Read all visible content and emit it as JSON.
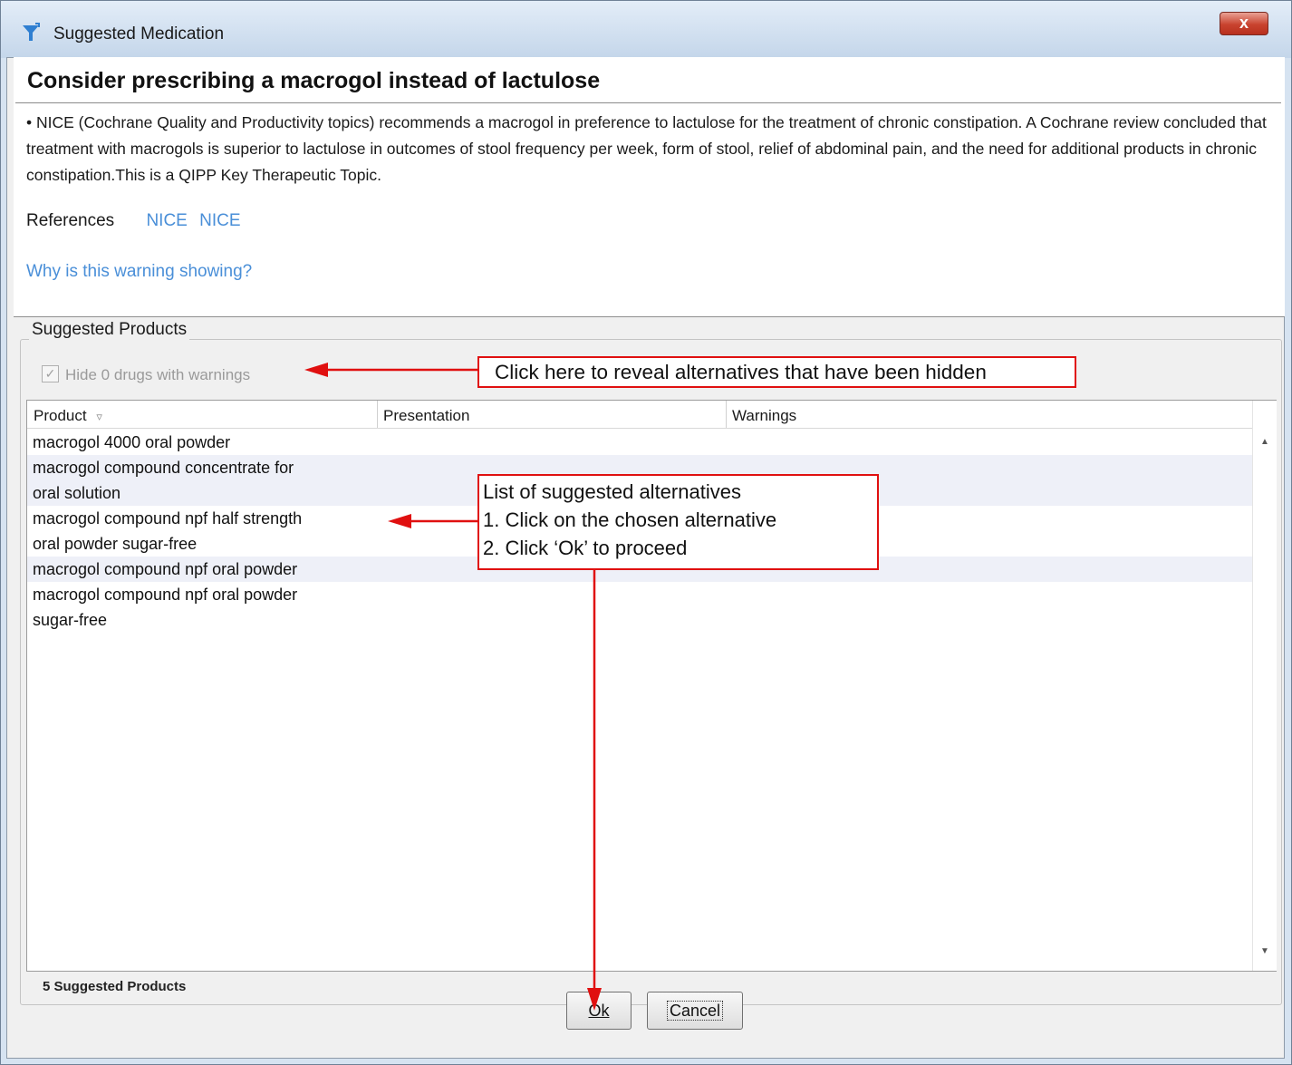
{
  "window": {
    "title": "Suggested Medication",
    "close_label": "x"
  },
  "warning": {
    "heading": "Consider prescribing a macrogol instead of lactulose",
    "body": "• NICE (Cochrane Quality and Productivity topics) recommends a macrogol in preference to lactulose for the treatment of chronic constipation. A Cochrane review concluded that treatment with macrogols is superior to lactulose in outcomes of stool frequency per week, form of stool, relief of abdominal pain, and the need for additional products in chronic constipation.This is a QIPP Key Therapeutic Topic.",
    "references_label": "References",
    "references": [
      "NICE",
      "NICE"
    ],
    "why_link": "Why is this warning showing?"
  },
  "suggested_products": {
    "group_label": "Suggested Products",
    "hide_checkbox_label": "Hide 0 drugs with warnings",
    "hide_checked": true,
    "columns": [
      "Product",
      "Presentation",
      "Warnings"
    ],
    "sort_indicator": "▿",
    "rows": [
      [
        "macrogol 4000 oral powder"
      ],
      [
        "macrogol compound concentrate for",
        "oral solution"
      ],
      [
        "macrogol compound npf half strength",
        "oral powder sugar-free"
      ],
      [
        "macrogol compound npf oral powder"
      ],
      [
        "macrogol compound npf oral powder",
        "sugar-free"
      ]
    ],
    "status": "5 Suggested Products"
  },
  "buttons": {
    "ok": "Ok",
    "cancel": "Cancel"
  },
  "annotations": {
    "reveal_hint": "Click here to reveal alternatives that have been hidden",
    "list_hint": [
      "List of suggested alternatives",
      "1. Click on the chosen alternative",
      "2. Click ‘Ok’ to proceed"
    ],
    "color": "#e01010"
  }
}
